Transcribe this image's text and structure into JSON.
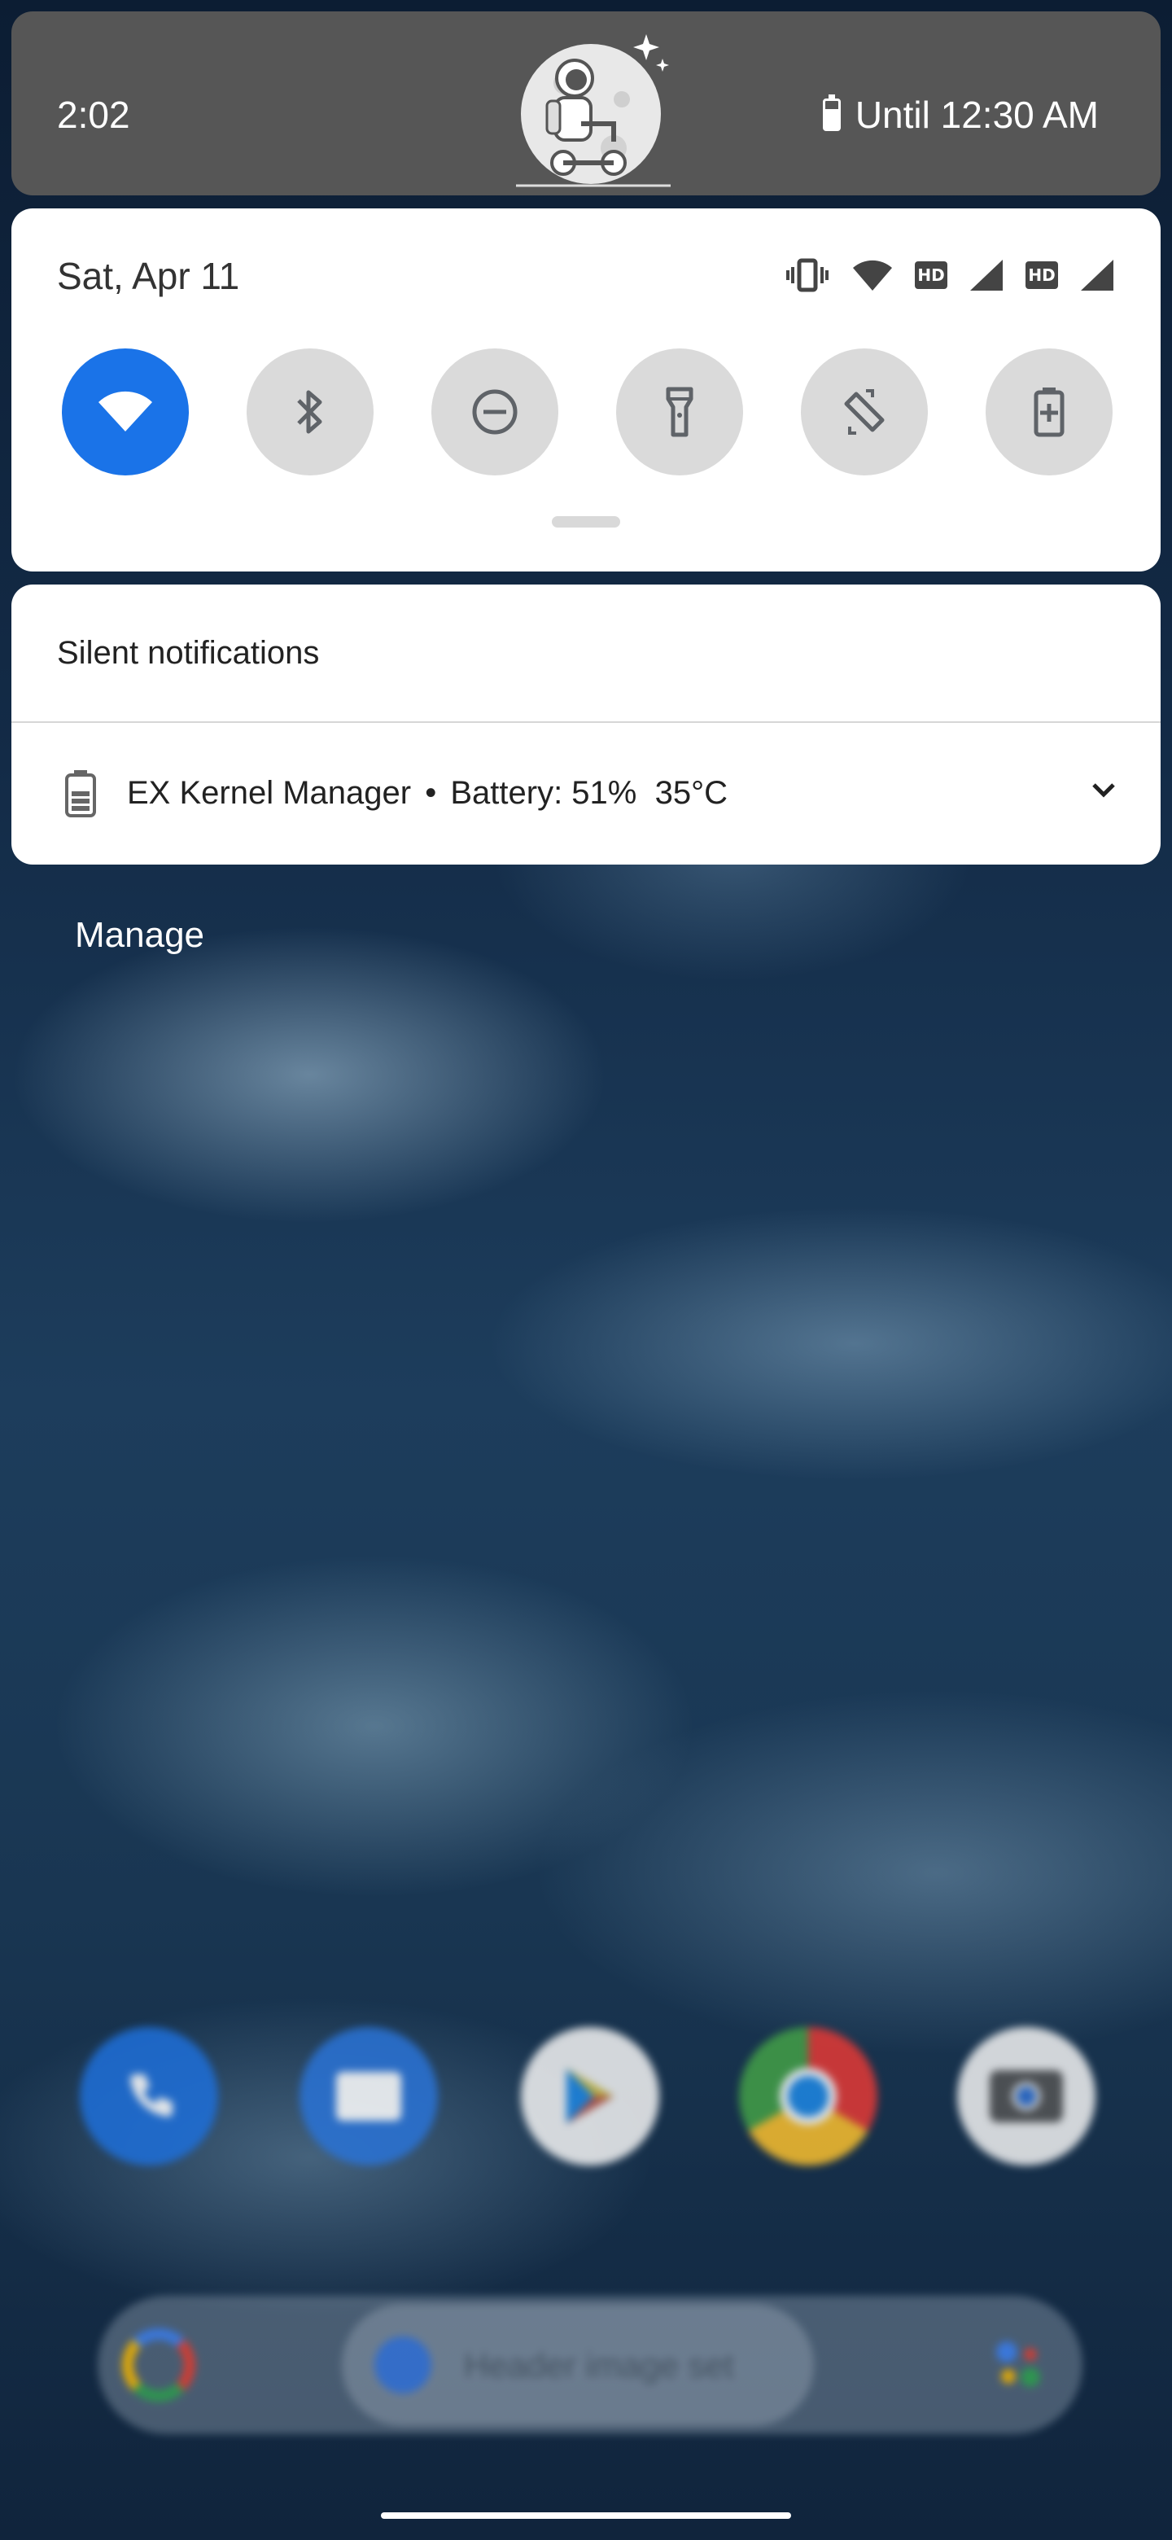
{
  "status_bar": {
    "time": "2:02",
    "battery_text": "Until 12:30 AM",
    "battery_icon": "battery-saver-icon"
  },
  "quick_settings": {
    "date": "Sat, Apr 11",
    "status_icons": [
      "vibrate-icon",
      "wifi-signal-icon",
      "hd-badge",
      "cell-signal-icon",
      "hd-badge",
      "cell-signal-icon"
    ],
    "hd_label": "HD",
    "tiles": [
      {
        "name": "wifi",
        "active": true
      },
      {
        "name": "bluetooth",
        "active": false
      },
      {
        "name": "do-not-disturb",
        "active": false
      },
      {
        "name": "flashlight",
        "active": false
      },
      {
        "name": "auto-rotate",
        "active": false
      },
      {
        "name": "battery-saver",
        "active": false
      }
    ],
    "accent_color": "#1a73e8"
  },
  "notifications": {
    "section_title": "Silent notifications",
    "items": [
      {
        "app": "EX Kernel Manager",
        "separator": "•",
        "content": "Battery: 51%  35°C",
        "icon": "battery-icon"
      }
    ],
    "manage_label": "Manage"
  },
  "home_screen": {
    "dock_apps": [
      "phone-icon",
      "messages-icon",
      "play-store-icon",
      "chrome-icon",
      "camera-icon"
    ],
    "search_placeholder": "Header image set"
  }
}
